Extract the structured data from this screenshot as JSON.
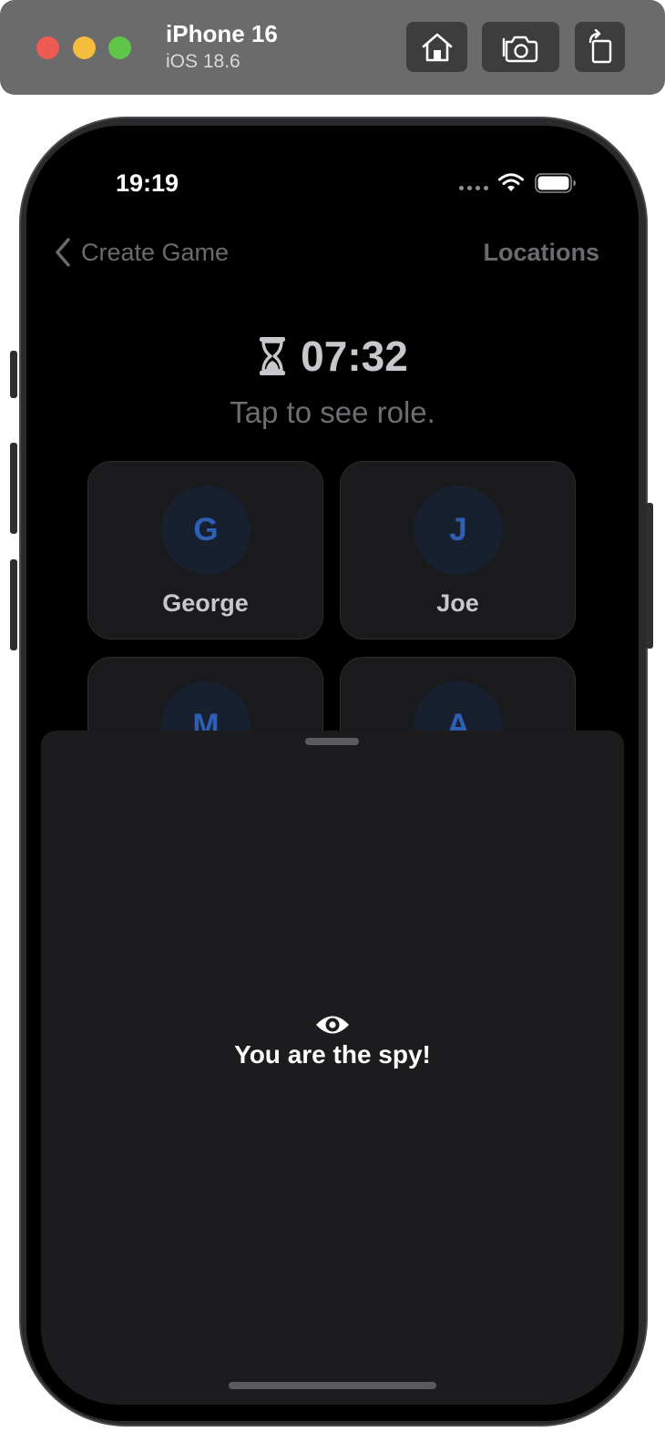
{
  "simulator": {
    "device_name": "iPhone 16",
    "os_version": "iOS 18.6",
    "buttons": [
      "home-icon",
      "screenshot-icon",
      "rotate-icon"
    ]
  },
  "status_bar": {
    "time": "19:19"
  },
  "nav": {
    "back_label": "Create Game",
    "right_label": "Locations"
  },
  "timer": {
    "value": "07:32",
    "icon": "hourglass-icon"
  },
  "hint": "Tap to see role.",
  "players": [
    {
      "initial": "G",
      "name": "George"
    },
    {
      "initial": "J",
      "name": "Joe"
    },
    {
      "initial": "M",
      "name": ""
    },
    {
      "initial": "A",
      "name": ""
    }
  ],
  "sheet": {
    "icon": "eye-icon",
    "message": "You are the spy!"
  },
  "colors": {
    "accent": "#2e5fb5",
    "background": "#000000",
    "sheet": "#1c1c1e",
    "card": "#1a1a1c"
  }
}
